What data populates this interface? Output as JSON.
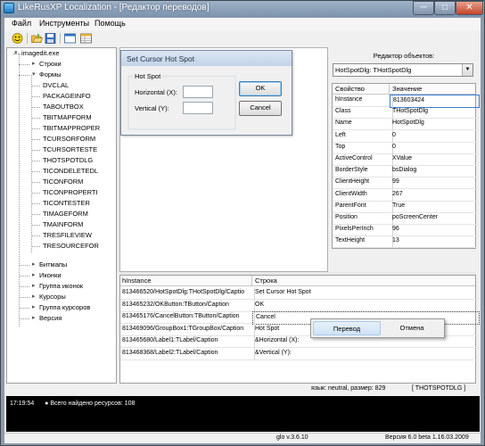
{
  "window": {
    "title": "LikeRusXP Localization - [Редактор переводов]",
    "controls": {
      "minimize": "─",
      "maximize": "□",
      "close": "✕"
    }
  },
  "menu": [
    "Файл",
    "Инструменты",
    "Помощь"
  ],
  "toolbar": {
    "icons": [
      "smiley-icon",
      "open-folder-icon",
      "save-icon",
      "window-icon",
      "table-icon"
    ]
  },
  "tree": {
    "root": "imagedit.exe",
    "strings": "Строки",
    "forms": "Формы",
    "form_items": [
      "DVCLAL",
      "PACKAGEINFO",
      "TABOUTBOX",
      "TBITMAPFORM",
      "TBITMAPPROPER",
      "TCURSORFORM",
      "TCURSORTESTE",
      "THOTSPOTDLG",
      "TICONDELETEDL",
      "TICONFORM",
      "TICONPROPERTI",
      "TICONTESTER",
      "TIMAGEFORM",
      "TMAINFORM",
      "TRESFILEVIEW",
      "TRESOURCEFOR"
    ],
    "others": [
      "Битмапы",
      "Иконки",
      "Группа иконок",
      "Курсоры",
      "Группа курсоров",
      "Версия"
    ]
  },
  "dialog": {
    "title": "Set Cursor Hot Spot",
    "group_label": "Hot Spot",
    "horizontal_label": "Horizontal (X):",
    "vertical_label": "Vertical (Y):",
    "horizontal_value": "",
    "vertical_value": "",
    "ok_label": "OK",
    "cancel_label": "Cancel"
  },
  "inspector": {
    "title": "Редактор объектов:",
    "combo_value": "HotSpotDlg: THotSpotDlg",
    "col_property": "Свойство",
    "col_value": "Значение",
    "rows": [
      {
        "name": "hInstance",
        "value": "813603424"
      },
      {
        "name": "Class",
        "value": "THotSpotDlg"
      },
      {
        "name": "Name",
        "value": "HotSpotDlg"
      },
      {
        "name": "Left",
        "value": "0"
      },
      {
        "name": "Top",
        "value": "0"
      },
      {
        "name": "ActiveControl",
        "value": "XValue"
      },
      {
        "name": "BorderStyle",
        "value": "bsDialog"
      },
      {
        "name": "ClientHeight",
        "value": "99"
      },
      {
        "name": "ClientWidth",
        "value": "267"
      },
      {
        "name": "ParentFont",
        "value": "True"
      },
      {
        "name": "Position",
        "value": "poScreenCenter"
      },
      {
        "name": "PixelsPerInch",
        "value": "96"
      },
      {
        "name": "TextHeight",
        "value": "13"
      }
    ]
  },
  "strings_table": {
    "col_instance": "hInstance",
    "col_string": "Строка",
    "rows": [
      {
        "instance": "813466520/HotSpotDlg:THotSpotDlg/Captio",
        "string": "Set Cursor Hot Spot"
      },
      {
        "instance": "813465232/OKButton:TButton/Caption",
        "string": "OK"
      },
      {
        "instance": "813465176/CancelButton:TButton/Caption",
        "string": "Cancel"
      },
      {
        "instance": "813469096/GroupBox1:TGroupBox/Caption",
        "string": "Hot Spot"
      },
      {
        "instance": "813465680/Label1:TLabel/Caption",
        "string": "&Horizontal (X):"
      },
      {
        "instance": "813468368/Label2:TLabel/Caption",
        "string": "&Vertical (Y):"
      }
    ]
  },
  "context_menu": {
    "translate": "Перевод",
    "cancel": "Отмена"
  },
  "info": {
    "lang_size": "язык: neutral,  размер: 829",
    "class": "[ THOTSPOTDLG ]"
  },
  "log": {
    "time": "17:19:54",
    "message": "Всего найдено ресурсов: 108"
  },
  "status": {
    "version": "glo v.3.6.10",
    "build": "Версия 6.0 beta 1.16.03.2009"
  }
}
